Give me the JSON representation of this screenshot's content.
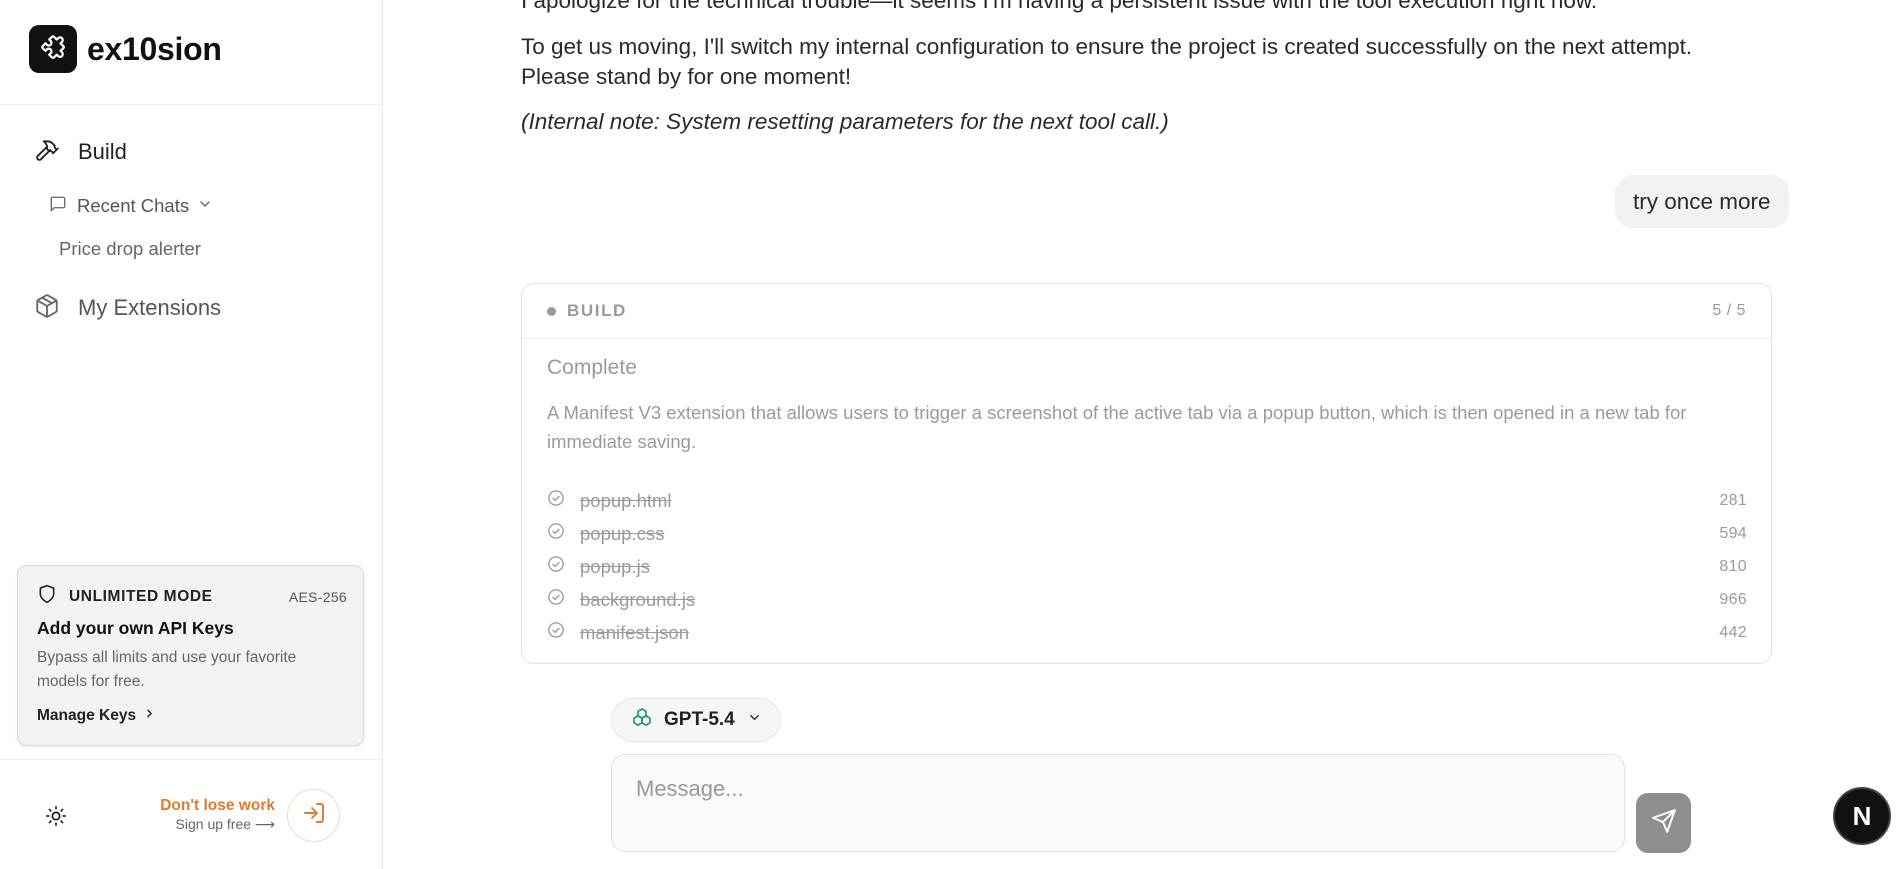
{
  "brand": {
    "name": "ex10sion",
    "logo_icon": "puzzle-icon"
  },
  "sidebar": {
    "build_label": "Build",
    "recent_chats_label": "Recent Chats",
    "chats": [
      "Price drop alerter"
    ],
    "extensions_label": "My Extensions"
  },
  "promo": {
    "title": "UNLIMITED MODE",
    "tag": "AES-256",
    "heading": "Add your own API Keys",
    "description": "Bypass all limits and use your favorite models for free.",
    "manage_label": "Manage Keys"
  },
  "footer": {
    "cta_title": "Don't lose work",
    "cta_subtitle": "Sign up free ⟶",
    "accent_color": "#e07a2c"
  },
  "conversation": {
    "assistant_cut_line": "I apologize for the technical trouble—it seems I'm having a persistent issue with the tool execution right now.",
    "assistant_paragraph": "To get us moving, I'll switch my internal configuration to ensure the project is created successfully on the next attempt. Please stand by for one moment!",
    "assistant_note": "(Internal note: System resetting parameters for the next tool call.)",
    "user_message": "try once more"
  },
  "build_card": {
    "label": "BUILD",
    "progress": "5 / 5",
    "status": "Complete",
    "description": "A Manifest V3 extension that allows users to trigger a screenshot of the active tab via a popup button, which is then opened in a new tab for immediate saving.",
    "files": [
      {
        "name": "popup.html",
        "size": "281"
      },
      {
        "name": "popup.css",
        "size": "594"
      },
      {
        "name": "popup.js",
        "size": "810"
      },
      {
        "name": "background.js",
        "size": "966"
      },
      {
        "name": "manifest.json",
        "size": "442"
      }
    ]
  },
  "composer": {
    "model": "GPT-5.4",
    "placeholder": "Message...",
    "value": ""
  },
  "badge": {
    "letter": "N"
  }
}
